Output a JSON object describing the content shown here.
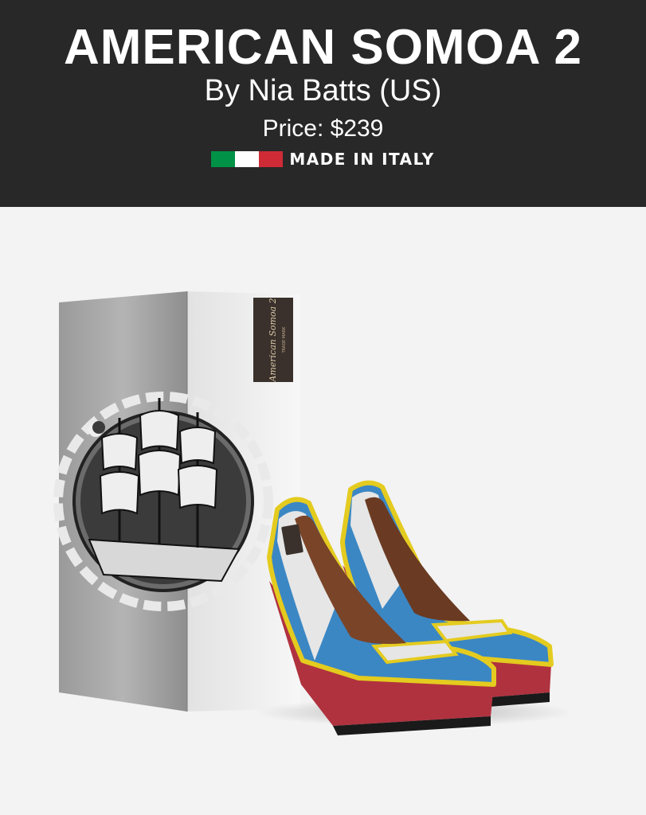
{
  "product": {
    "title": "AMERICAN SOMOA 2",
    "byline": "By Nia Batts (US)",
    "price": "Price: $239",
    "made_in": "MADE IN ITALY",
    "box_label_line1": "American Somoa 2",
    "box_label_line2": "TRADE MARK"
  },
  "colors": {
    "header_bg": "#282828",
    "flag_green": "#009246",
    "flag_white": "#ffffff",
    "flag_red": "#ce2b37",
    "shoe_blue": "#3b87c4",
    "shoe_red": "#b0323f",
    "shoe_yellow": "#e4cb1f"
  },
  "icons": {
    "flag": "italy-flag-icon"
  }
}
